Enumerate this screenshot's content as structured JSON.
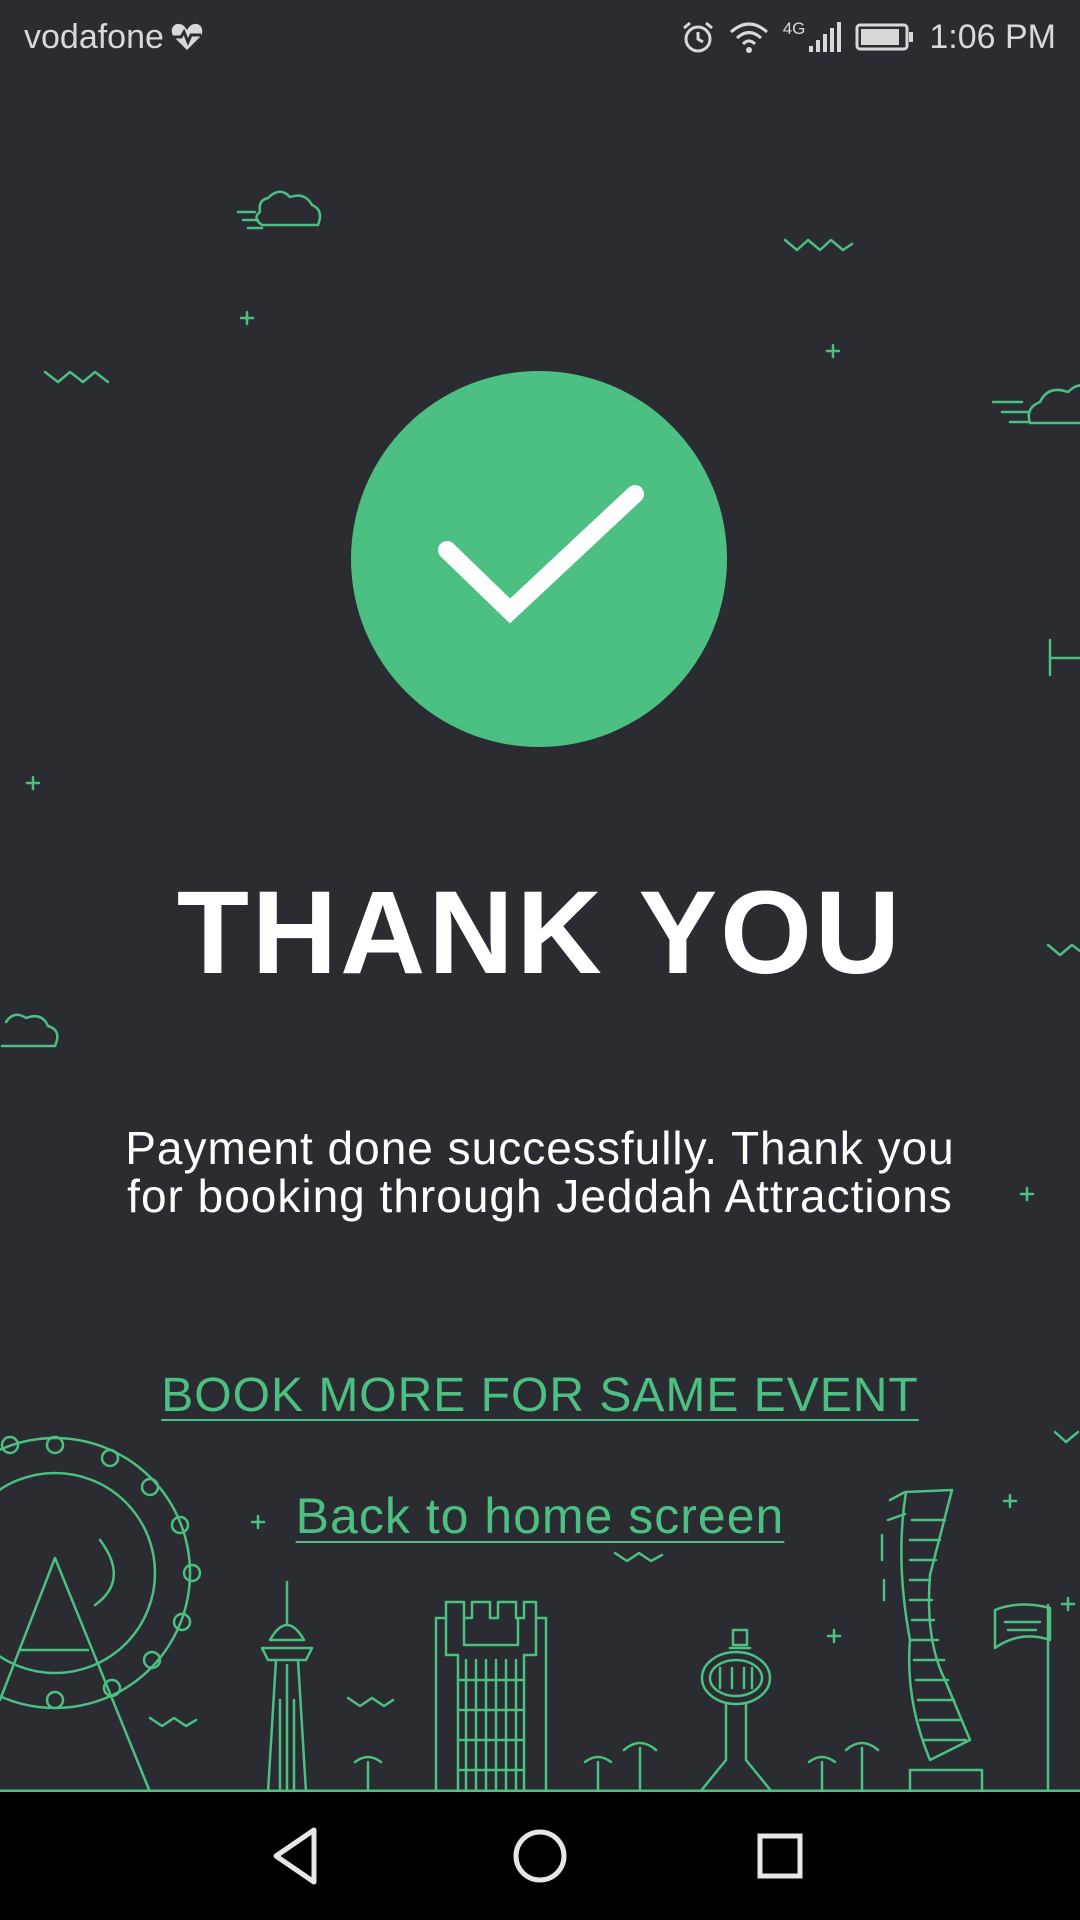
{
  "status_bar": {
    "carrier": "vodafone",
    "network": "4G",
    "time": "1:06 PM"
  },
  "confirmation": {
    "title": "THANK YOU",
    "message": "Payment done successfully. Thank you for booking through Jeddah Attractions"
  },
  "actions": {
    "book_more_label": "BOOK MORE FOR SAME EVENT",
    "back_home_label": "Back to home screen"
  },
  "colors": {
    "background": "#2a2c31",
    "accent": "#4cc082",
    "text": "#ffffff",
    "nav_bar": "#000000"
  },
  "icons": {
    "status_bar": [
      "heart-pulse-icon",
      "alarm-icon",
      "wifi-icon",
      "signal-icon",
      "battery-icon"
    ],
    "confirmation": "checkmark-icon",
    "nav_bar": [
      "back-triangle-icon",
      "home-circle-icon",
      "recents-square-icon"
    ]
  }
}
